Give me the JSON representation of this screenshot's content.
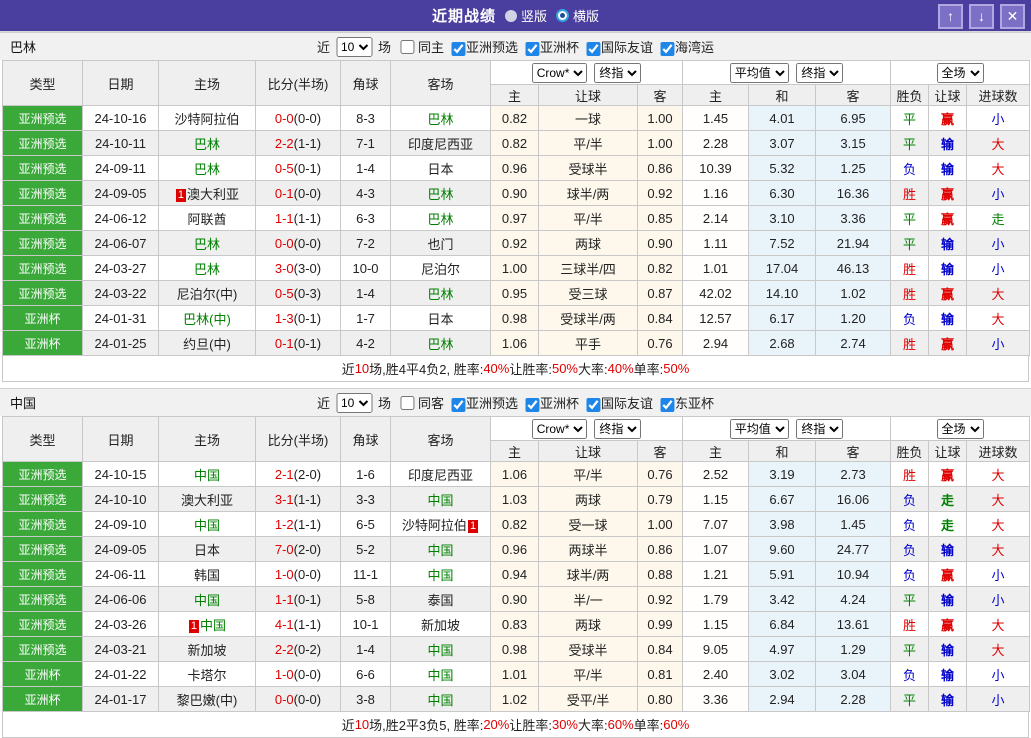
{
  "titlebar": {
    "title": "近期战绩",
    "radios": [
      {
        "label": "竖版",
        "selected": false
      },
      {
        "label": "横版",
        "selected": true
      }
    ],
    "buttons": {
      "up": "↑",
      "down": "↓",
      "close": "✕"
    }
  },
  "colors": {
    "titlebar_purple": "#4a3f9e",
    "type_green": "#3aa93a",
    "win_red": "#e00000",
    "draw_green": "#008000",
    "loss_blue": "#0000cc",
    "crow_cream": "#fdf7ec",
    "avg_lightblue": "#e9f4fa",
    "checkbox_blue": "#1e86e8"
  },
  "header": {
    "cols": [
      "类型",
      "日期",
      "主场",
      "比分(半场)",
      "角球",
      "客场"
    ],
    "subs": [
      "主",
      "让球",
      "客",
      "主",
      "和",
      "客",
      "胜负",
      "让球",
      "进球数"
    ],
    "dropdowns": {
      "crow": "Crow*",
      "final": "终指",
      "avg": "平均值",
      "full": "全场"
    }
  },
  "sections": [
    {
      "team": "巴林",
      "filter": {
        "prefix": "近",
        "count": "10",
        "suffix": "场",
        "same_label": "同主",
        "same_checked": false,
        "competitions": [
          "亚洲预选",
          "亚洲杯",
          "国际友谊",
          "海湾运"
        ]
      },
      "rows": [
        {
          "type": "亚洲预选",
          "date": "24-10-16",
          "home": "沙特阿拉伯",
          "score": "0-0",
          "half": "(0-0)",
          "corner": "8-3",
          "away": "巴林",
          "away_color": "green",
          "crow_home": "0.82",
          "crow_line": "一球",
          "crow_away": "1.00",
          "avg_home": "1.45",
          "avg_draw": "4.01",
          "avg_away": "6.95",
          "wdl": "平",
          "wdl_color": "green",
          "handicap": "赢",
          "handicap_color": "red",
          "goals": "小",
          "goals_color": "blue"
        },
        {
          "type": "亚洲预选",
          "date": "24-10-11",
          "home": "巴林",
          "home_color": "green",
          "score": "2-2",
          "half": "(1-1)",
          "corner": "7-1",
          "away": "印度尼西亚",
          "crow_home": "0.82",
          "crow_line": "平/半",
          "crow_away": "1.00",
          "avg_home": "2.28",
          "avg_draw": "3.07",
          "avg_away": "3.15",
          "wdl": "平",
          "wdl_color": "green",
          "handicap": "输",
          "handicap_color": "blue",
          "goals": "大",
          "goals_color": "red"
        },
        {
          "type": "亚洲预选",
          "date": "24-09-11",
          "home": "巴林",
          "home_color": "green",
          "score": "0-5",
          "half": "(0-1)",
          "corner": "1-4",
          "away": "日本",
          "crow_home": "0.96",
          "crow_line": "受球半",
          "crow_away": "0.86",
          "avg_home": "10.39",
          "avg_draw": "5.32",
          "avg_away": "1.25",
          "wdl": "负",
          "wdl_color": "blue",
          "handicap": "输",
          "handicap_color": "blue",
          "goals": "大",
          "goals_color": "red"
        },
        {
          "type": "亚洲预选",
          "date": "24-09-05",
          "home": "澳大利亚",
          "home_badge_before": "1",
          "score": "0-1",
          "half": "(0-0)",
          "corner": "4-3",
          "away": "巴林",
          "away_color": "green",
          "crow_home": "0.90",
          "crow_line": "球半/两",
          "crow_away": "0.92",
          "avg_home": "1.16",
          "avg_draw": "6.30",
          "avg_away": "16.36",
          "wdl": "胜",
          "wdl_color": "red",
          "handicap": "赢",
          "handicap_color": "red",
          "goals": "小",
          "goals_color": "blue"
        },
        {
          "type": "亚洲预选",
          "date": "24-06-12",
          "home": "阿联酋",
          "score": "1-1",
          "half": "(1-1)",
          "corner": "6-3",
          "away": "巴林",
          "away_color": "green",
          "crow_home": "0.97",
          "crow_line": "平/半",
          "crow_away": "0.85",
          "avg_home": "2.14",
          "avg_draw": "3.10",
          "avg_away": "3.36",
          "wdl": "平",
          "wdl_color": "green",
          "handicap": "赢",
          "handicap_color": "red",
          "goals": "走",
          "goals_color": "green"
        },
        {
          "type": "亚洲预选",
          "date": "24-06-07",
          "home": "巴林",
          "home_color": "green",
          "score": "0-0",
          "half": "(0-0)",
          "corner": "7-2",
          "away": "也门",
          "crow_home": "0.92",
          "crow_line": "两球",
          "crow_away": "0.90",
          "avg_home": "1.11",
          "avg_draw": "7.52",
          "avg_away": "21.94",
          "wdl": "平",
          "wdl_color": "green",
          "handicap": "输",
          "handicap_color": "blue",
          "goals": "小",
          "goals_color": "blue"
        },
        {
          "type": "亚洲预选",
          "date": "24-03-27",
          "home": "巴林",
          "home_color": "green",
          "score": "3-0",
          "half": "(3-0)",
          "corner": "10-0",
          "away": "尼泊尔",
          "crow_home": "1.00",
          "crow_line": "三球半/四",
          "crow_away": "0.82",
          "avg_home": "1.01",
          "avg_draw": "17.04",
          "avg_away": "46.13",
          "wdl": "胜",
          "wdl_color": "red",
          "handicap": "输",
          "handicap_color": "blue",
          "goals": "小",
          "goals_color": "blue"
        },
        {
          "type": "亚洲预选",
          "date": "24-03-22",
          "home": "尼泊尔(中)",
          "score": "0-5",
          "half": "(0-3)",
          "corner": "1-4",
          "away": "巴林",
          "away_color": "green",
          "crow_home": "0.95",
          "crow_line": "受三球",
          "crow_away": "0.87",
          "avg_home": "42.02",
          "avg_draw": "14.10",
          "avg_away": "1.02",
          "wdl": "胜",
          "wdl_color": "red",
          "handicap": "赢",
          "handicap_color": "red",
          "goals": "大",
          "goals_color": "red"
        },
        {
          "type": "亚洲杯",
          "date": "24-01-31",
          "home": "巴林(中)",
          "home_color": "green",
          "score": "1-3",
          "half": "(0-1)",
          "corner": "1-7",
          "away": "日本",
          "crow_home": "0.98",
          "crow_line": "受球半/两",
          "crow_away": "0.84",
          "avg_home": "12.57",
          "avg_draw": "6.17",
          "avg_away": "1.20",
          "wdl": "负",
          "wdl_color": "blue",
          "handicap": "输",
          "handicap_color": "blue",
          "goals": "大",
          "goals_color": "red"
        },
        {
          "type": "亚洲杯",
          "date": "24-01-25",
          "home": "约旦(中)",
          "score": "0-1",
          "half": "(0-1)",
          "corner": "4-2",
          "away": "巴林",
          "away_color": "green",
          "crow_home": "1.06",
          "crow_line": "平手",
          "crow_away": "0.76",
          "avg_home": "2.94",
          "avg_draw": "2.68",
          "avg_away": "2.74",
          "wdl": "胜",
          "wdl_color": "red",
          "handicap": "赢",
          "handicap_color": "red",
          "goals": "小",
          "goals_color": "blue"
        }
      ],
      "summary_segments": [
        {
          "text": "近",
          "red": false
        },
        {
          "text": "10",
          "red": true
        },
        {
          "text": "场,胜4平4负2, 胜率:",
          "red": false
        },
        {
          "text": "40%",
          "red": true
        },
        {
          "text": " 让胜率:",
          "red": false
        },
        {
          "text": "50%",
          "red": true
        },
        {
          "text": " 大率:",
          "red": false
        },
        {
          "text": "40%",
          "red": true
        },
        {
          "text": " 单率:",
          "red": false
        },
        {
          "text": "50%",
          "red": true
        }
      ]
    },
    {
      "team": "中国",
      "filter": {
        "prefix": "近",
        "count": "10",
        "suffix": "场",
        "same_label": "同客",
        "same_checked": false,
        "competitions": [
          "亚洲预选",
          "亚洲杯",
          "国际友谊",
          "东亚杯"
        ]
      },
      "rows": [
        {
          "type": "亚洲预选",
          "date": "24-10-15",
          "home": "中国",
          "home_color": "green",
          "score": "2-1",
          "half": "(2-0)",
          "corner": "1-6",
          "away": "印度尼西亚",
          "crow_home": "1.06",
          "crow_line": "平/半",
          "crow_away": "0.76",
          "avg_home": "2.52",
          "avg_draw": "3.19",
          "avg_away": "2.73",
          "wdl": "胜",
          "wdl_color": "red",
          "handicap": "赢",
          "handicap_color": "red",
          "goals": "大",
          "goals_color": "red"
        },
        {
          "type": "亚洲预选",
          "date": "24-10-10",
          "home": "澳大利亚",
          "score": "3-1",
          "half": "(1-1)",
          "corner": "3-3",
          "away": "中国",
          "away_color": "green",
          "crow_home": "1.03",
          "crow_line": "两球",
          "crow_away": "0.79",
          "avg_home": "1.15",
          "avg_draw": "6.67",
          "avg_away": "16.06",
          "wdl": "负",
          "wdl_color": "blue",
          "handicap": "走",
          "handicap_color": "green",
          "goals": "大",
          "goals_color": "red"
        },
        {
          "type": "亚洲预选",
          "date": "24-09-10",
          "home": "中国",
          "home_color": "green",
          "score": "1-2",
          "half": "(1-1)",
          "corner": "6-5",
          "away": "沙特阿拉伯",
          "away_badge_after": "1",
          "crow_home": "0.82",
          "crow_line": "受一球",
          "crow_away": "1.00",
          "avg_home": "7.07",
          "avg_draw": "3.98",
          "avg_away": "1.45",
          "wdl": "负",
          "wdl_color": "blue",
          "handicap": "走",
          "handicap_color": "green",
          "goals": "大",
          "goals_color": "red"
        },
        {
          "type": "亚洲预选",
          "date": "24-09-05",
          "home": "日本",
          "score": "7-0",
          "half": "(2-0)",
          "corner": "5-2",
          "away": "中国",
          "away_color": "green",
          "crow_home": "0.96",
          "crow_line": "两球半",
          "crow_away": "0.86",
          "avg_home": "1.07",
          "avg_draw": "9.60",
          "avg_away": "24.77",
          "wdl": "负",
          "wdl_color": "blue",
          "handicap": "输",
          "handicap_color": "blue",
          "goals": "大",
          "goals_color": "red"
        },
        {
          "type": "亚洲预选",
          "date": "24-06-11",
          "home": "韩国",
          "score": "1-0",
          "half": "(0-0)",
          "corner": "11-1",
          "away": "中国",
          "away_color": "green",
          "crow_home": "0.94",
          "crow_line": "球半/两",
          "crow_away": "0.88",
          "avg_home": "1.21",
          "avg_draw": "5.91",
          "avg_away": "10.94",
          "wdl": "负",
          "wdl_color": "blue",
          "handicap": "赢",
          "handicap_color": "red",
          "goals": "小",
          "goals_color": "blue"
        },
        {
          "type": "亚洲预选",
          "date": "24-06-06",
          "home": "中国",
          "home_color": "green",
          "score": "1-1",
          "half": "(0-1)",
          "corner": "5-8",
          "away": "泰国",
          "crow_home": "0.90",
          "crow_line": "半/一",
          "crow_away": "0.92",
          "avg_home": "1.79",
          "avg_draw": "3.42",
          "avg_away": "4.24",
          "wdl": "平",
          "wdl_color": "green",
          "handicap": "输",
          "handicap_color": "blue",
          "goals": "小",
          "goals_color": "blue"
        },
        {
          "type": "亚洲预选",
          "date": "24-03-26",
          "home": "中国",
          "home_color": "green",
          "home_badge_before": "1",
          "score": "4-1",
          "half": "(1-1)",
          "corner": "10-1",
          "away": "新加坡",
          "crow_home": "0.83",
          "crow_line": "两球",
          "crow_away": "0.99",
          "avg_home": "1.15",
          "avg_draw": "6.84",
          "avg_away": "13.61",
          "wdl": "胜",
          "wdl_color": "red",
          "handicap": "赢",
          "handicap_color": "red",
          "goals": "大",
          "goals_color": "red"
        },
        {
          "type": "亚洲预选",
          "date": "24-03-21",
          "home": "新加坡",
          "score": "2-2",
          "half": "(0-2)",
          "corner": "1-4",
          "away": "中国",
          "away_color": "green",
          "crow_home": "0.98",
          "crow_line": "受球半",
          "crow_away": "0.84",
          "avg_home": "9.05",
          "avg_draw": "4.97",
          "avg_away": "1.29",
          "wdl": "平",
          "wdl_color": "green",
          "handicap": "输",
          "handicap_color": "blue",
          "goals": "大",
          "goals_color": "red"
        },
        {
          "type": "亚洲杯",
          "date": "24-01-22",
          "home": "卡塔尔",
          "score": "1-0",
          "half": "(0-0)",
          "corner": "6-6",
          "away": "中国",
          "away_color": "green",
          "crow_home": "1.01",
          "crow_line": "平/半",
          "crow_away": "0.81",
          "avg_home": "2.40",
          "avg_draw": "3.02",
          "avg_away": "3.04",
          "wdl": "负",
          "wdl_color": "blue",
          "handicap": "输",
          "handicap_color": "blue",
          "goals": "小",
          "goals_color": "blue"
        },
        {
          "type": "亚洲杯",
          "date": "24-01-17",
          "home": "黎巴嫩(中)",
          "score": "0-0",
          "half": "(0-0)",
          "corner": "3-8",
          "away": "中国",
          "away_color": "green",
          "crow_home": "1.02",
          "crow_line": "受平/半",
          "crow_away": "0.80",
          "avg_home": "3.36",
          "avg_draw": "2.94",
          "avg_away": "2.28",
          "wdl": "平",
          "wdl_color": "green",
          "handicap": "输",
          "handicap_color": "blue",
          "goals": "小",
          "goals_color": "blue"
        }
      ],
      "summary_segments": [
        {
          "text": "近",
          "red": false
        },
        {
          "text": "10",
          "red": true
        },
        {
          "text": "场,胜2平3负5, 胜率:",
          "red": false
        },
        {
          "text": "20%",
          "red": true
        },
        {
          "text": " 让胜率:",
          "red": false
        },
        {
          "text": "30%",
          "red": true
        },
        {
          "text": " 大率:",
          "red": false
        },
        {
          "text": "60%",
          "red": true
        },
        {
          "text": " 单率:",
          "red": false
        },
        {
          "text": "60%",
          "red": true
        }
      ]
    }
  ]
}
